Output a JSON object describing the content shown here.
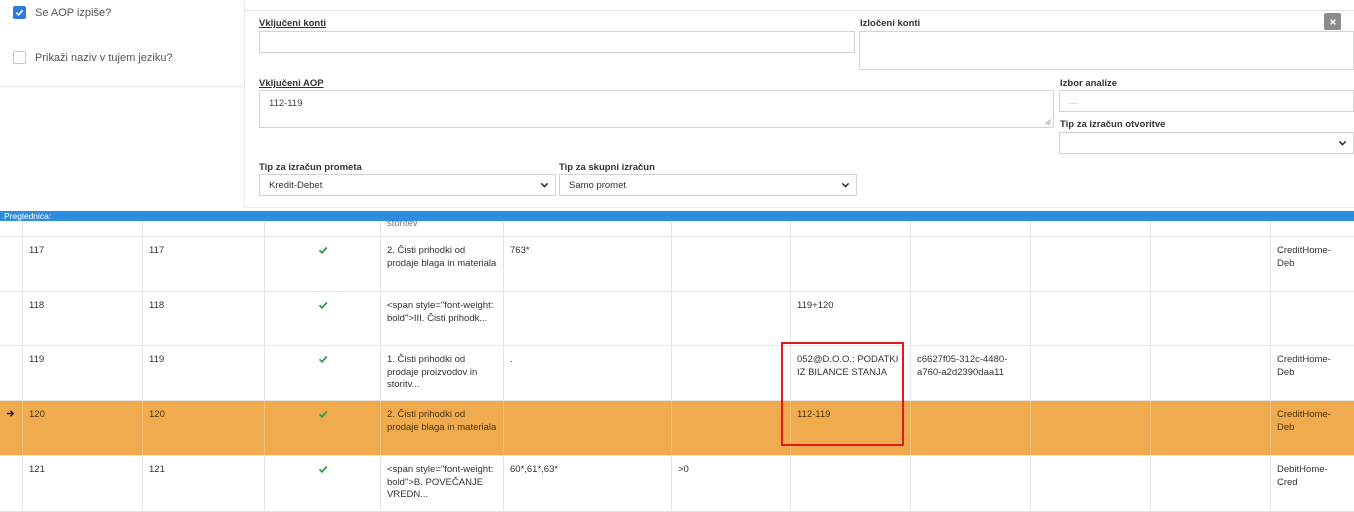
{
  "options": {
    "show_aop": {
      "label": "Se AOP izpiše?",
      "checked": true
    },
    "foreign_names": {
      "label": "Prikaži naziv v tujem jeziku?",
      "checked": false
    }
  },
  "form": {
    "included_accounts": {
      "label": "Vključeni konti",
      "value": ""
    },
    "excluded_accounts": {
      "label": "Izločeni konti",
      "value": ""
    },
    "included_aop": {
      "label": "Vključeni AOP",
      "value": "112-119"
    },
    "analysis": {
      "label": "Izbor analize",
      "placeholder": "..."
    },
    "opening_type": {
      "label": "Tip za izračun otvoritve",
      "value": ""
    },
    "turnover_type": {
      "label": "Tip za izračun prometa",
      "value": "Kredit-Debet"
    },
    "total_type": {
      "label": "Tip za skupni izračun",
      "value": "Samo promet"
    }
  },
  "grid": {
    "title": "Preglednica:",
    "partial_top_text": "storitev",
    "rows": [
      {
        "c1": "117",
        "c2": "117",
        "active": true,
        "name": "2. Čisti prihodki od prodaje blaga in materiala",
        "accounts": "763*",
        "condition": "",
        "formula": "",
        "guid": "",
        "type": "CreditHome-Deb",
        "selected": false
      },
      {
        "c1": "118",
        "c2": "118",
        "active": true,
        "name": "<span style=\"font-weight: bold\">III. Čisti prihodk...",
        "accounts": "",
        "condition": "",
        "formula": "119+120",
        "guid": "",
        "type": "",
        "selected": false
      },
      {
        "c1": "119",
        "c2": "119",
        "active": true,
        "name": "1. Čisti prihodki od prodaje proizvodov in storitv...",
        "accounts": ".",
        "condition": "",
        "formula": "052@D.O.O.: PODATKI IZ BILANCE STANJA",
        "guid": "c6627f05-312c-4480-a760-a2d2390daa11",
        "type": "CreditHome-Deb",
        "selected": false
      },
      {
        "c1": "120",
        "c2": "120",
        "active": true,
        "name": "2. Čisti prihodki od prodaje blaga in materiala",
        "accounts": "",
        "condition": "",
        "formula": "112-119",
        "guid": "",
        "type": "CreditHome-Deb",
        "selected": true
      },
      {
        "c1": "121",
        "c2": "121",
        "active": true,
        "name": "<span style=\"font-weight: bold\">B. POVEČANJE VREDN...",
        "accounts": "60*,61*,63*",
        "condition": ">0",
        "formula": "",
        "guid": "",
        "type": "DebitHome-Cred",
        "selected": false
      }
    ]
  },
  "colors": {
    "accent": "#2d8ee0",
    "selected_row": "#efab4d",
    "highlight_box": "#e11b1b",
    "check": "#2e9e44"
  }
}
